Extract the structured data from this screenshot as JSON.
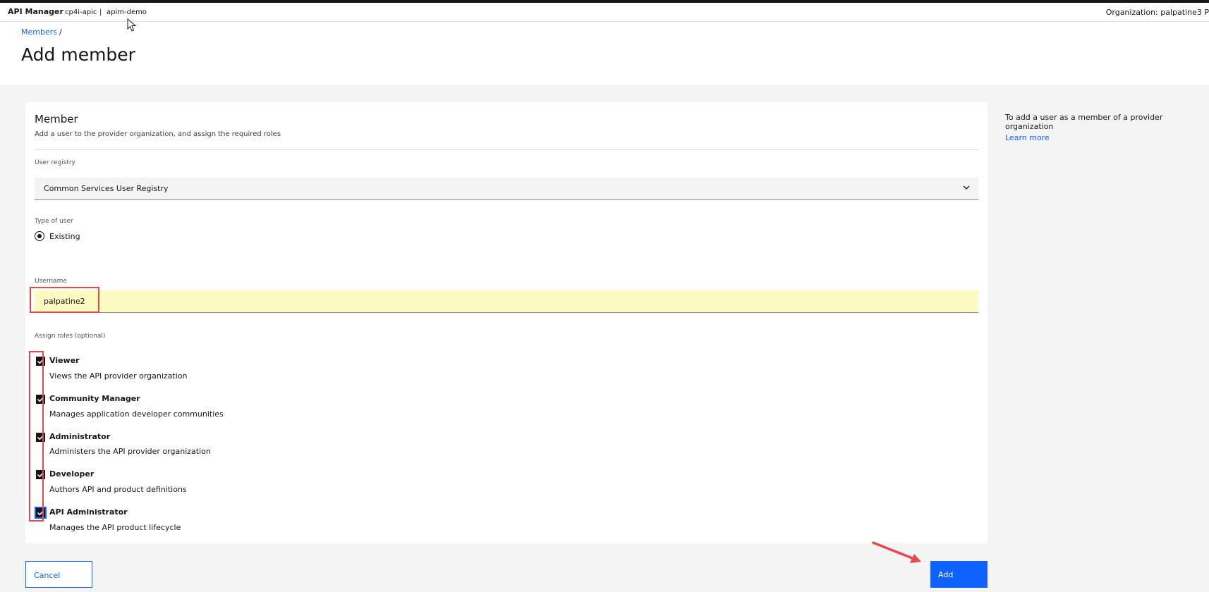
{
  "header": {
    "app_name": "API Manager",
    "context_1": "cp4i-apic",
    "separator": "|",
    "context_2": "apim-demo",
    "org_label": "Organization:",
    "org_value": "palpatine3 P"
  },
  "breadcrumb": {
    "link": "Members",
    "separator": "/"
  },
  "page_title": "Add member",
  "form": {
    "title": "Member",
    "subtitle": "Add a user to the provider organization, and assign the required roles",
    "registry_label": "User registry",
    "registry_value": "Common Services User Registry",
    "type_label": "Type of user",
    "type_option": "Existing",
    "username_label": "Username",
    "username_value": "palpatine2",
    "roles_label": "Assign roles (optional)",
    "roles": [
      {
        "name": "Viewer",
        "desc": "Views the API provider organization",
        "checked": true
      },
      {
        "name": "Community Manager",
        "desc": "Manages application developer communities",
        "checked": true
      },
      {
        "name": "Administrator",
        "desc": "Administers the API provider organization",
        "checked": true
      },
      {
        "name": "Developer",
        "desc": "Authors API and product definitions",
        "checked": true
      },
      {
        "name": "API Administrator",
        "desc": "Manages the API product lifecycle",
        "checked": true
      }
    ]
  },
  "sidebar": {
    "help_text": "To add a user as a member of a provider organization",
    "learn_more": "Learn more"
  },
  "actions": {
    "cancel": "Cancel",
    "add": "Add"
  },
  "colors": {
    "primary": "#0f62fe",
    "highlight": "#e5484d",
    "autofill": "#fafac1"
  }
}
